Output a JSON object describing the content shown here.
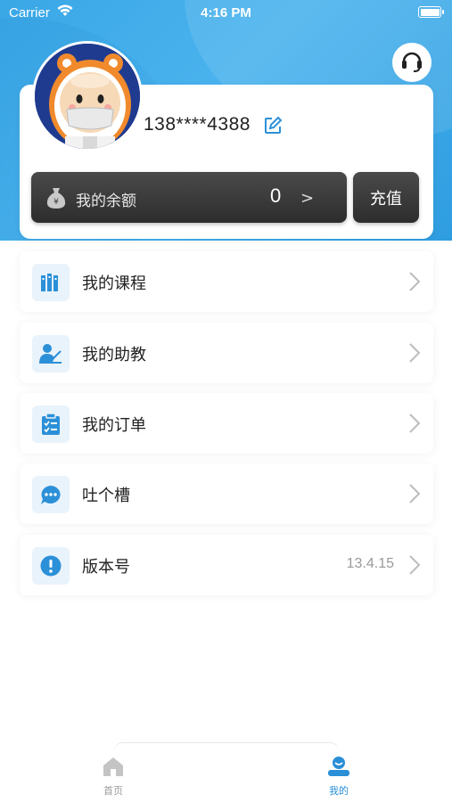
{
  "status_bar": {
    "carrier": "Carrier",
    "time": "4:16 PM"
  },
  "profile": {
    "phone": "138****4388",
    "balance_label": "我的余额",
    "balance_value": "0",
    "balance_arrow": ">",
    "recharge_label": "充值"
  },
  "menu": {
    "items": [
      {
        "label": "我的课程",
        "icon": "books-icon"
      },
      {
        "label": "我的助教",
        "icon": "teacher-icon"
      },
      {
        "label": "我的订单",
        "icon": "order-icon"
      },
      {
        "label": "吐个槽",
        "icon": "chat-icon"
      },
      {
        "label": "版本号",
        "icon": "info-icon",
        "value": "13.4.15"
      }
    ]
  },
  "tabbar": {
    "home_label": "首页",
    "mine_label": "我的"
  },
  "colors": {
    "header_blue": "#3aa7e6",
    "accent_blue": "#2a8fd6",
    "icon_blue": "#2c90d8",
    "dark_button": "#3a3a3a"
  }
}
